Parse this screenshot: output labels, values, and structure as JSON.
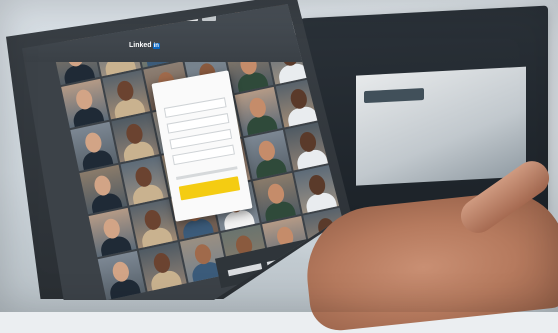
{
  "brand": {
    "logo_text": "Linked",
    "logo_in": "in",
    "accent": "#0a66c2"
  },
  "signup": {
    "cta_color": "#f4cc12",
    "field_count": 4
  },
  "photo_grid": {
    "tiles": 48
  }
}
